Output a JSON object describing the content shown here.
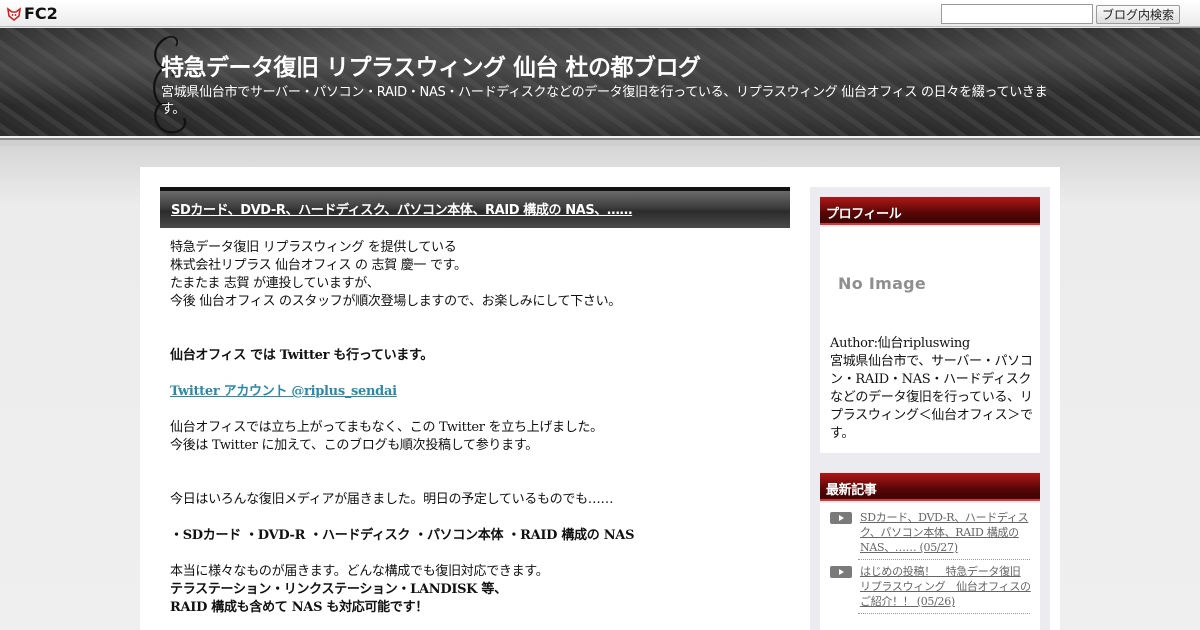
{
  "topbar": {
    "logo_text": "FC2",
    "search_placeholder": "",
    "search_button": "ブログ内検索"
  },
  "header": {
    "title": "特急データ復旧 リプラスウィング 仙台 杜の都ブログ",
    "description": "宮城県仙台市でサーバー・パソコン・RAID・NAS・ハードディスクなどのデータ復旧を行っている、リプラスウィング 仙台オフィス の日々を綴っていきます。"
  },
  "entry": {
    "title": "SDカード、DVD-R、ハードディスク、パソコン本体、RAID 構成の NAS、……",
    "lines": [
      {
        "text": "特急データ復旧 リプラスウィング を提供している",
        "style": "normal"
      },
      {
        "text": "株式会社リプラス 仙台オフィス の 志賀 慶一 です。",
        "style": "normal"
      },
      {
        "text": "たまたま 志賀 が連投していますが、",
        "style": "normal"
      },
      {
        "text": "今後 仙台オフィス のスタッフが順次登場しますので、お楽しみにして下さい。",
        "style": "normal"
      },
      {
        "text": "",
        "style": "blank"
      },
      {
        "text": "",
        "style": "blank"
      },
      {
        "text": "仙台オフィス では Twitter も行っています。",
        "style": "bold"
      },
      {
        "text": "",
        "style": "blank"
      },
      {
        "text": "Twitter アカウント @riplus_sendai",
        "style": "link"
      },
      {
        "text": "",
        "style": "blank"
      },
      {
        "text": "仙台オフィスでは立ち上がってまもなく、この Twitter を立ち上げました。",
        "style": "normal"
      },
      {
        "text": "今後は Twitter に加えて、このブログも順次投稿して参ります。",
        "style": "normal"
      },
      {
        "text": "",
        "style": "blank"
      },
      {
        "text": "",
        "style": "blank"
      },
      {
        "text": "今日はいろんな復旧メディアが届きました。明日の予定しているものでも……",
        "style": "normal"
      },
      {
        "text": "",
        "style": "blank"
      },
      {
        "text": "・SDカード ・DVD-R ・ハードディスク ・パソコン本体 ・RAID 構成の NAS",
        "style": "bold"
      },
      {
        "text": "",
        "style": "blank"
      },
      {
        "text": "本当に様々なものが届きます。どんな構成でも復旧対応できます。",
        "style": "normal"
      },
      {
        "text": "テラステーション・リンクステーション・LANDISK 等、",
        "style": "bold"
      },
      {
        "text": "RAID 構成も含めて NAS も対応可能です！",
        "style": "bold"
      }
    ]
  },
  "sidebar": {
    "profile_title": "プロフィール",
    "noimage_text": "No Image",
    "author": "Author:仙台ripluswing",
    "profile_desc": "宮城県仙台市で、サーバー・パソコン・RAID・NAS・ハードディスクなどのデータ復旧を行っている、リプラスウィング＜仙台オフィス＞です。",
    "recent_title": "最新記事",
    "recent": [
      {
        "label": "SDカード、DVD-R、ハードディスク、パソコン本体、RAID 構成の NAS、…… (05/27)"
      },
      {
        "label": "はじめの投稿！　特急データ復旧 リプラスウィング　仙台オフィスのご紹介！！ (05/26)"
      }
    ]
  },
  "colors": {
    "widget_head": "#8a0b0b",
    "link": "#2a8aa8",
    "header_bg": "#333333"
  }
}
